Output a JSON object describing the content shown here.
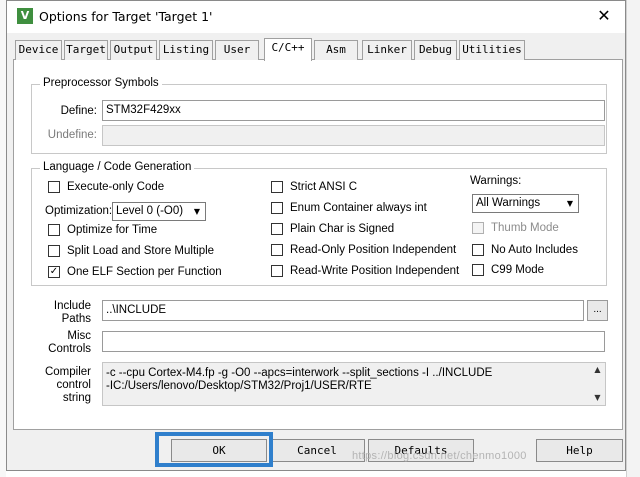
{
  "dialog": {
    "title": "Options for Target 'Target 1'",
    "app_icon_letter": "V",
    "close_glyph": "✕"
  },
  "tabs": [
    {
      "label": "Device"
    },
    {
      "label": "Target"
    },
    {
      "label": "Output"
    },
    {
      "label": "Listing"
    },
    {
      "label": "User"
    },
    {
      "label": "C/C++"
    },
    {
      "label": "Asm"
    },
    {
      "label": "Linker"
    },
    {
      "label": "Debug"
    },
    {
      "label": "Utilities"
    }
  ],
  "active_tab": "C/C++",
  "preprocessor": {
    "group_title": "Preprocessor Symbols",
    "define_label": "Define:",
    "define_value": "STM32F429xx",
    "undefine_label": "Undefine:",
    "undefine_value": ""
  },
  "language": {
    "group_title": "Language / Code Generation",
    "execute_only": {
      "label": "Execute-only Code",
      "checked": false
    },
    "optimization_label": "Optimization:",
    "optimization_value": "Level 0 (-O0)",
    "optimize_time": {
      "label": "Optimize for Time",
      "checked": false
    },
    "split_load": {
      "label": "Split Load and Store Multiple",
      "checked": false
    },
    "one_elf": {
      "label": "One ELF Section per Function",
      "checked": true
    },
    "strict_ansi": {
      "label": "Strict ANSI C",
      "checked": false
    },
    "enum_container": {
      "label": "Enum Container always int",
      "checked": false
    },
    "plain_char": {
      "label": "Plain Char is Signed",
      "checked": false
    },
    "ro_pi": {
      "label": "Read-Only Position Independent",
      "checked": false
    },
    "rw_pi": {
      "label": "Read-Write Position Independent",
      "checked": false
    },
    "warnings_label": "Warnings:",
    "warnings_value": "All Warnings",
    "thumb_mode": {
      "label": "Thumb Mode",
      "checked": false,
      "disabled": true
    },
    "no_auto_includes": {
      "label": "No Auto Includes",
      "checked": false
    },
    "c99_mode": {
      "label": "C99 Mode",
      "checked": false
    }
  },
  "include": {
    "label_line1": "Include",
    "label_line2": "Paths",
    "value": "..\\INCLUDE",
    "browse_label": "..."
  },
  "misc": {
    "label_line1": "Misc",
    "label_line2": "Controls",
    "value": ""
  },
  "compiler": {
    "label_line1": "Compiler",
    "label_line2": "control",
    "label_line3": "string",
    "line1": "-c --cpu Cortex-M4.fp -g -O0 --apcs=interwork --split_sections -I ../INCLUDE",
    "line2": "-IC:/Users/lenovo/Desktop/STM32/Proj1/USER/RTE"
  },
  "buttons": {
    "ok": "OK",
    "cancel": "Cancel",
    "defaults": "Defaults",
    "help": "Help"
  },
  "watermark": "https://blog.csdn.net/chenmo1000",
  "colors": {
    "highlight_border": "#2f7fcc"
  }
}
